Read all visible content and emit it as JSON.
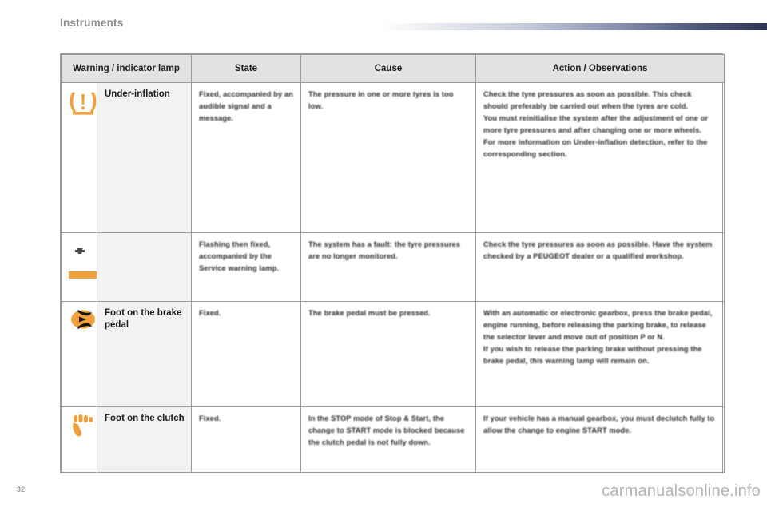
{
  "document": {
    "chapter_title": "Instruments",
    "page_number": "32",
    "watermark": "carmanualsonline.info",
    "accent_color": "#f0a03c",
    "header_bar_color": "#2e3550"
  },
  "table": {
    "headers": [
      "Warning / indicator lamp",
      "State",
      "Cause",
      "Action / Observations"
    ],
    "rows": [
      {
        "lamp_icon": "tyre-under-inflation-icon",
        "lamp_name": "Under-inflation",
        "state": "Fixed, accompanied by an audible signal and a message.",
        "cause": "The pressure in one or more tyres is too low.",
        "action": "Check the tyre pressures as soon as possible. This check should preferably be carried out when the tyres are cold.\nYou must reinitialise the system after the adjustment of one or more tyre pressures and after changing one or more wheels.\nFor more information on Under-inflation detection, refer to the corresponding section."
      },
      {
        "lamp_icon": "tyre-pressure-fault-icon",
        "lamp_name": "",
        "state": "Flashing then fixed, accompanied by the Service warning lamp.",
        "cause": "The system has a fault: the tyre pressures are no longer monitored.",
        "action": "Check the tyre pressures as soon as possible. Have the system checked by a PEUGEOT dealer or a qualified workshop."
      },
      {
        "lamp_icon": "foot-on-brake-pedal-icon",
        "lamp_name": "Foot on the brake pedal",
        "state": "Fixed.",
        "cause": "The brake pedal must be pressed.",
        "action": "With an automatic or electronic gearbox, press the brake pedal, engine running, before releasing the parking brake, to release the selector lever and move out of position P or N.\nIf you wish to release the parking brake without pressing the brake pedal, this warning lamp will remain on."
      },
      {
        "lamp_icon": "foot-on-clutch-icon",
        "lamp_name": "Foot on the clutch",
        "state": "Fixed.",
        "cause": "In the STOP mode of Stop & Start, the change to START mode is blocked because the clutch pedal is not fully down.",
        "action": "If your vehicle has a manual gearbox, you must declutch fully to allow the change to engine START mode."
      }
    ]
  }
}
